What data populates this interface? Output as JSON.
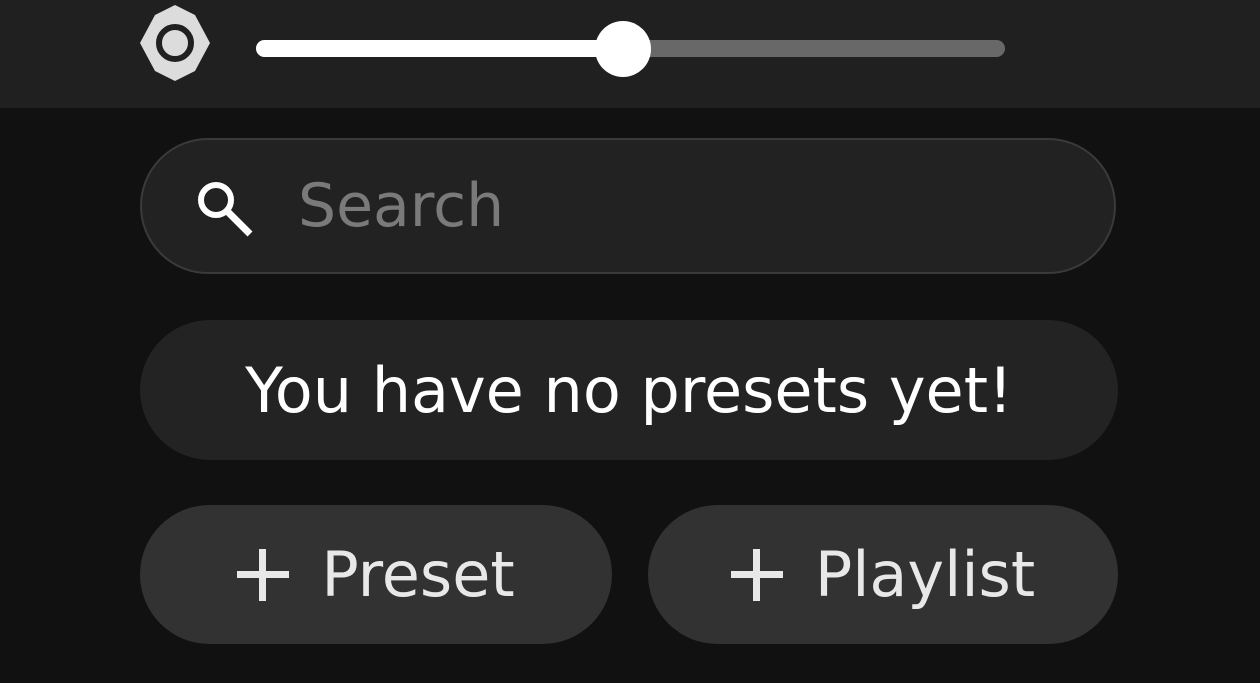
{
  "brightness": {
    "icon": "brightness-icon",
    "level_percent": 49
  },
  "search": {
    "icon": "search-icon",
    "placeholder": "Search",
    "value": ""
  },
  "presets": {
    "empty_message": "You have no presets yet!"
  },
  "actions": {
    "add_preset_label": "Preset",
    "add_playlist_label": "Playlist",
    "icon": "plus-icon"
  },
  "colors": {
    "background": "#111111",
    "top_bar": "#202020",
    "search_bg": "#222222",
    "message_bg": "#232323",
    "button_bg": "#323232",
    "slider_track": "#686868",
    "slider_fill": "#ffffff"
  }
}
